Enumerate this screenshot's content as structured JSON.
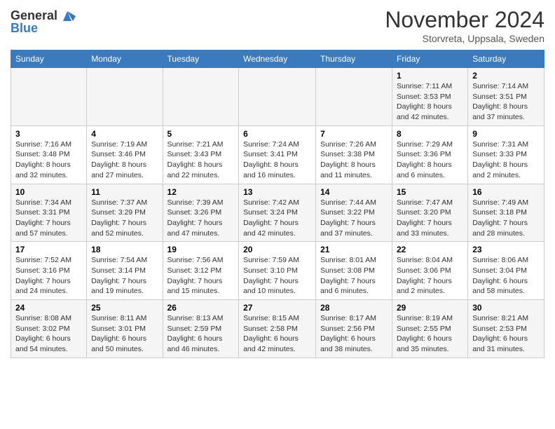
{
  "header": {
    "logo_line1": "General",
    "logo_line2": "Blue",
    "month": "November 2024",
    "location": "Storvreta, Uppsala, Sweden"
  },
  "weekdays": [
    "Sunday",
    "Monday",
    "Tuesday",
    "Wednesday",
    "Thursday",
    "Friday",
    "Saturday"
  ],
  "weeks": [
    [
      {
        "day": "",
        "info": ""
      },
      {
        "day": "",
        "info": ""
      },
      {
        "day": "",
        "info": ""
      },
      {
        "day": "",
        "info": ""
      },
      {
        "day": "",
        "info": ""
      },
      {
        "day": "1",
        "info": "Sunrise: 7:11 AM\nSunset: 3:53 PM\nDaylight: 8 hours and 42 minutes."
      },
      {
        "day": "2",
        "info": "Sunrise: 7:14 AM\nSunset: 3:51 PM\nDaylight: 8 hours and 37 minutes."
      }
    ],
    [
      {
        "day": "3",
        "info": "Sunrise: 7:16 AM\nSunset: 3:48 PM\nDaylight: 8 hours and 32 minutes."
      },
      {
        "day": "4",
        "info": "Sunrise: 7:19 AM\nSunset: 3:46 PM\nDaylight: 8 hours and 27 minutes."
      },
      {
        "day": "5",
        "info": "Sunrise: 7:21 AM\nSunset: 3:43 PM\nDaylight: 8 hours and 22 minutes."
      },
      {
        "day": "6",
        "info": "Sunrise: 7:24 AM\nSunset: 3:41 PM\nDaylight: 8 hours and 16 minutes."
      },
      {
        "day": "7",
        "info": "Sunrise: 7:26 AM\nSunset: 3:38 PM\nDaylight: 8 hours and 11 minutes."
      },
      {
        "day": "8",
        "info": "Sunrise: 7:29 AM\nSunset: 3:36 PM\nDaylight: 8 hours and 6 minutes."
      },
      {
        "day": "9",
        "info": "Sunrise: 7:31 AM\nSunset: 3:33 PM\nDaylight: 8 hours and 2 minutes."
      }
    ],
    [
      {
        "day": "10",
        "info": "Sunrise: 7:34 AM\nSunset: 3:31 PM\nDaylight: 7 hours and 57 minutes."
      },
      {
        "day": "11",
        "info": "Sunrise: 7:37 AM\nSunset: 3:29 PM\nDaylight: 7 hours and 52 minutes."
      },
      {
        "day": "12",
        "info": "Sunrise: 7:39 AM\nSunset: 3:26 PM\nDaylight: 7 hours and 47 minutes."
      },
      {
        "day": "13",
        "info": "Sunrise: 7:42 AM\nSunset: 3:24 PM\nDaylight: 7 hours and 42 minutes."
      },
      {
        "day": "14",
        "info": "Sunrise: 7:44 AM\nSunset: 3:22 PM\nDaylight: 7 hours and 37 minutes."
      },
      {
        "day": "15",
        "info": "Sunrise: 7:47 AM\nSunset: 3:20 PM\nDaylight: 7 hours and 33 minutes."
      },
      {
        "day": "16",
        "info": "Sunrise: 7:49 AM\nSunset: 3:18 PM\nDaylight: 7 hours and 28 minutes."
      }
    ],
    [
      {
        "day": "17",
        "info": "Sunrise: 7:52 AM\nSunset: 3:16 PM\nDaylight: 7 hours and 24 minutes."
      },
      {
        "day": "18",
        "info": "Sunrise: 7:54 AM\nSunset: 3:14 PM\nDaylight: 7 hours and 19 minutes."
      },
      {
        "day": "19",
        "info": "Sunrise: 7:56 AM\nSunset: 3:12 PM\nDaylight: 7 hours and 15 minutes."
      },
      {
        "day": "20",
        "info": "Sunrise: 7:59 AM\nSunset: 3:10 PM\nDaylight: 7 hours and 10 minutes."
      },
      {
        "day": "21",
        "info": "Sunrise: 8:01 AM\nSunset: 3:08 PM\nDaylight: 7 hours and 6 minutes."
      },
      {
        "day": "22",
        "info": "Sunrise: 8:04 AM\nSunset: 3:06 PM\nDaylight: 7 hours and 2 minutes."
      },
      {
        "day": "23",
        "info": "Sunrise: 8:06 AM\nSunset: 3:04 PM\nDaylight: 6 hours and 58 minutes."
      }
    ],
    [
      {
        "day": "24",
        "info": "Sunrise: 8:08 AM\nSunset: 3:02 PM\nDaylight: 6 hours and 54 minutes."
      },
      {
        "day": "25",
        "info": "Sunrise: 8:11 AM\nSunset: 3:01 PM\nDaylight: 6 hours and 50 minutes."
      },
      {
        "day": "26",
        "info": "Sunrise: 8:13 AM\nSunset: 2:59 PM\nDaylight: 6 hours and 46 minutes."
      },
      {
        "day": "27",
        "info": "Sunrise: 8:15 AM\nSunset: 2:58 PM\nDaylight: 6 hours and 42 minutes."
      },
      {
        "day": "28",
        "info": "Sunrise: 8:17 AM\nSunset: 2:56 PM\nDaylight: 6 hours and 38 minutes."
      },
      {
        "day": "29",
        "info": "Sunrise: 8:19 AM\nSunset: 2:55 PM\nDaylight: 6 hours and 35 minutes."
      },
      {
        "day": "30",
        "info": "Sunrise: 8:21 AM\nSunset: 2:53 PM\nDaylight: 6 hours and 31 minutes."
      }
    ]
  ]
}
